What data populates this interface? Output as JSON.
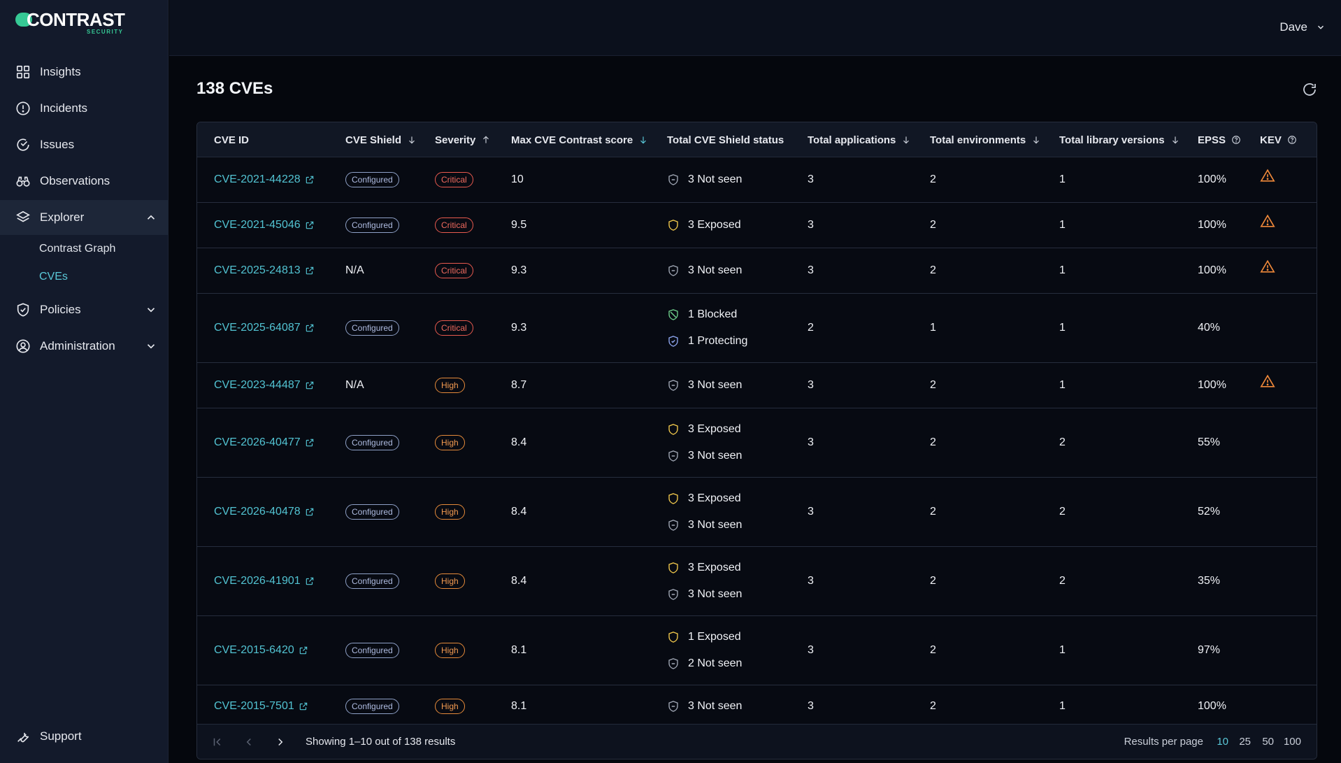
{
  "brand": {
    "name": "CONTRAST",
    "sub": "SECURITY",
    "accent": "#36c995"
  },
  "user": {
    "name": "Dave"
  },
  "sidebar": {
    "items": [
      {
        "label": "Insights",
        "icon": "grid-icon"
      },
      {
        "label": "Incidents",
        "icon": "alert-circle-icon"
      },
      {
        "label": "Issues",
        "icon": "issues-icon"
      },
      {
        "label": "Observations",
        "icon": "binoculars-icon"
      },
      {
        "label": "Explorer",
        "icon": "layers-icon"
      },
      {
        "label": "Policies",
        "icon": "shield-check-icon"
      },
      {
        "label": "Administration",
        "icon": "user-circle-icon"
      }
    ],
    "explorer_sub": [
      "Contrast Graph",
      "CVEs"
    ],
    "support": "Support"
  },
  "page": {
    "title": "138 CVEs"
  },
  "table": {
    "headers": {
      "cve_id": "CVE ID",
      "shield": "CVE Shield",
      "severity": "Severity",
      "score": "Max CVE Contrast score",
      "status": "Total CVE Shield status",
      "apps": "Total applications",
      "envs": "Total environments",
      "libs": "Total library versions",
      "epss": "EPSS",
      "kev": "KEV"
    },
    "rows": [
      {
        "id": "CVE-2021-44228",
        "shield": "Configured",
        "severity": "Critical",
        "score": "10",
        "statuses": [
          {
            "kind": "notseen",
            "text": "3 Not seen"
          }
        ],
        "apps": "3",
        "envs": "2",
        "libs": "1",
        "epss": "100%",
        "kev": true
      },
      {
        "id": "CVE-2021-45046",
        "shield": "Configured",
        "severity": "Critical",
        "score": "9.5",
        "statuses": [
          {
            "kind": "exposed",
            "text": "3 Exposed"
          }
        ],
        "apps": "3",
        "envs": "2",
        "libs": "1",
        "epss": "100%",
        "kev": true
      },
      {
        "id": "CVE-2025-24813",
        "shield": "N/A",
        "severity": "Critical",
        "score": "9.3",
        "statuses": [
          {
            "kind": "notseen",
            "text": "3 Not seen"
          }
        ],
        "apps": "3",
        "envs": "2",
        "libs": "1",
        "epss": "100%",
        "kev": true
      },
      {
        "id": "CVE-2025-64087",
        "shield": "Configured",
        "severity": "Critical",
        "score": "9.3",
        "statuses": [
          {
            "kind": "blocked",
            "text": "1 Blocked"
          },
          {
            "kind": "protecting",
            "text": "1 Protecting"
          }
        ],
        "apps": "2",
        "envs": "1",
        "libs": "1",
        "epss": "40%",
        "kev": false
      },
      {
        "id": "CVE-2023-44487",
        "shield": "N/A",
        "severity": "High",
        "score": "8.7",
        "statuses": [
          {
            "kind": "notseen",
            "text": "3 Not seen"
          }
        ],
        "apps": "3",
        "envs": "2",
        "libs": "1",
        "epss": "100%",
        "kev": true
      },
      {
        "id": "CVE-2026-40477",
        "shield": "Configured",
        "severity": "High",
        "score": "8.4",
        "statuses": [
          {
            "kind": "exposed",
            "text": "3 Exposed"
          },
          {
            "kind": "notseen",
            "text": "3 Not seen"
          }
        ],
        "apps": "3",
        "envs": "2",
        "libs": "2",
        "epss": "55%",
        "kev": false
      },
      {
        "id": "CVE-2026-40478",
        "shield": "Configured",
        "severity": "High",
        "score": "8.4",
        "statuses": [
          {
            "kind": "exposed",
            "text": "3 Exposed"
          },
          {
            "kind": "notseen",
            "text": "3 Not seen"
          }
        ],
        "apps": "3",
        "envs": "2",
        "libs": "2",
        "epss": "52%",
        "kev": false
      },
      {
        "id": "CVE-2026-41901",
        "shield": "Configured",
        "severity": "High",
        "score": "8.4",
        "statuses": [
          {
            "kind": "exposed",
            "text": "3 Exposed"
          },
          {
            "kind": "notseen",
            "text": "3 Not seen"
          }
        ],
        "apps": "3",
        "envs": "2",
        "libs": "2",
        "epss": "35%",
        "kev": false
      },
      {
        "id": "CVE-2015-6420",
        "shield": "Configured",
        "severity": "High",
        "score": "8.1",
        "statuses": [
          {
            "kind": "exposed",
            "text": "1 Exposed"
          },
          {
            "kind": "notseen",
            "text": "2 Not seen"
          }
        ],
        "apps": "3",
        "envs": "2",
        "libs": "1",
        "epss": "97%",
        "kev": false
      },
      {
        "id": "CVE-2015-7501",
        "shield": "Configured",
        "severity": "High",
        "score": "8.1",
        "statuses": [
          {
            "kind": "notseen",
            "text": "3 Not seen"
          }
        ],
        "apps": "3",
        "envs": "2",
        "libs": "1",
        "epss": "100%",
        "kev": false
      }
    ]
  },
  "footer": {
    "showing": "Showing 1–10 out of 138 results",
    "rpp_label": "Results per page",
    "rpp_options": [
      "10",
      "25",
      "50",
      "100"
    ],
    "rpp_selected": "10"
  },
  "colors": {
    "link": "#52c3d2",
    "critical": "#f06a5e",
    "high": "#f29a50",
    "exposed": "#f2c94c",
    "notseen": "#a0a7b4",
    "blocked": "#6fd08c",
    "protecting": "#8ea6ef",
    "kev": "#f0893a"
  }
}
